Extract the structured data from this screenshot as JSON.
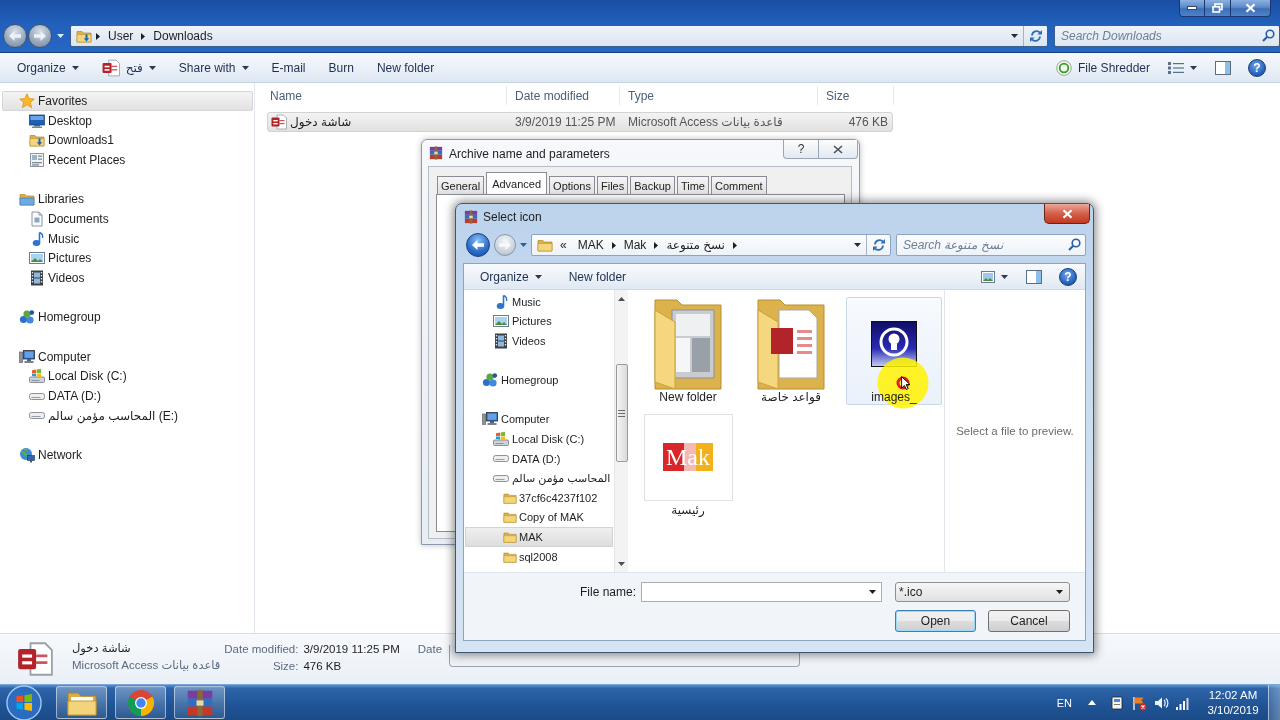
{
  "explorer": {
    "address": {
      "path": [
        "User",
        "Downloads"
      ]
    },
    "search": {
      "placeholder": "Search Downloads"
    },
    "toolbar": [
      {
        "kind": "menu",
        "label": "Organize"
      },
      {
        "kind": "app-menu",
        "label": "فتح"
      },
      {
        "kind": "menu",
        "label": "Share with"
      },
      {
        "kind": "command",
        "label": "E-mail"
      },
      {
        "kind": "command",
        "label": "Burn"
      },
      {
        "kind": "command",
        "label": "New folder"
      }
    ],
    "shredder": {
      "label": "File Shredder"
    },
    "help": "?",
    "sidebar": [
      {
        "label": "Favorites",
        "kind": "favorites",
        "selected": true,
        "children": [
          {
            "label": "Desktop",
            "kind": "desktop",
            "selected": false
          },
          {
            "label": "Downloads1",
            "kind": "downloads",
            "selected": false
          },
          {
            "label": "Recent Places",
            "kind": "recent",
            "selected": false
          }
        ]
      },
      {
        "label": "Libraries",
        "kind": "libraries",
        "selected": false,
        "children": [
          {
            "label": "Documents",
            "kind": "documents",
            "selected": false
          },
          {
            "label": "Music",
            "kind": "music",
            "selected": false
          },
          {
            "label": "Pictures",
            "kind": "pictures",
            "selected": false
          },
          {
            "label": "Videos",
            "kind": "videos",
            "selected": false
          }
        ]
      },
      {
        "label": "Homegroup",
        "kind": "homegroup",
        "selected": false
      },
      {
        "label": "Computer",
        "kind": "computer",
        "selected": false,
        "children": [
          {
            "label": "Local Disk (C:)",
            "kind": "system-drive",
            "selected": false
          },
          {
            "label": "DATA (D:)",
            "kind": "drive",
            "selected": false
          },
          {
            "label": "المحاسب مؤمن سالم (E:)",
            "kind": "drive",
            "selected": false
          }
        ]
      },
      {
        "label": "Network",
        "kind": "network",
        "selected": false
      }
    ],
    "columns": [
      "Name",
      "Date modified",
      "Type",
      "Size"
    ],
    "rows": [
      {
        "name": "شاشة دخول",
        "date_modified": "3/9/2019 11:25 PM",
        "type": "Microsoft Access قاعدة بيانات",
        "size": "476 KB",
        "selected": true
      }
    ],
    "details": {
      "name": "شاشة دخول",
      "type": "Microsoft Access قاعدة بيانات",
      "field_columns": [
        [
          {
            "label": "Date modified:",
            "value": "3/9/2019 11:25 PM"
          },
          {
            "label": "Size:",
            "value": "476 KB"
          }
        ],
        [
          {
            "label": "Date"
          }
        ]
      ]
    }
  },
  "archive_dialog": {
    "title": "Archive name and parameters",
    "help": "?",
    "tabs": [
      {
        "label": "General",
        "selected": false
      },
      {
        "label": "Advanced",
        "selected": true
      },
      {
        "label": "Options",
        "selected": false
      },
      {
        "label": "Files",
        "selected": false
      },
      {
        "label": "Backup",
        "selected": false
      },
      {
        "label": "Time",
        "selected": false
      },
      {
        "label": "Comment",
        "selected": false
      }
    ]
  },
  "select_icon_dialog": {
    "title": "Select icon",
    "address": {
      "overflow": "«",
      "path": [
        "MAK",
        "Mak",
        "نسخ متنوعة"
      ]
    },
    "search": {
      "placeholder": "Search نسخ متنوعة"
    },
    "toolbar": [
      {
        "kind": "menu",
        "label": "Organize"
      },
      {
        "kind": "command",
        "label": "New folder"
      }
    ],
    "help": "?",
    "tree": [
      {
        "children": [
          {
            "label": "Music",
            "kind": "music",
            "selected": false
          },
          {
            "label": "Pictures",
            "kind": "pictures",
            "selected": false
          },
          {
            "label": "Videos",
            "kind": "videos",
            "selected": false
          }
        ]
      },
      {
        "label": "Homegroup",
        "kind": "homegroup",
        "selected": false
      },
      {
        "label": "Computer",
        "kind": "computer",
        "selected": false,
        "children": [
          {
            "label": "Local Disk (C:)",
            "kind": "system-drive",
            "selected": false
          },
          {
            "label": "DATA (D:)",
            "kind": "drive",
            "selected": false
          },
          {
            "label": "المحاسب مؤمن سالم",
            "kind": "drive",
            "selected": false,
            "children": [
              {
                "label": "37cf6c4237f102",
                "kind": "folder",
                "selected": false
              },
              {
                "label": "Copy of MAK",
                "kind": "folder",
                "selected": false
              },
              {
                "label": "MAK",
                "kind": "folder",
                "selected": true
              },
              {
                "label": "sql2008",
                "kind": "folder",
                "selected": false
              }
            ]
          }
        ]
      }
    ],
    "items": [
      {
        "label": "New folder",
        "kind": "folder-documents",
        "hovered": false
      },
      {
        "label": "قواعد خاصة",
        "kind": "folder-access",
        "hovered": false
      },
      {
        "label": "images_",
        "kind": "icon-bulb",
        "hovered": true
      },
      {
        "label": "رئيسية",
        "kind": "icon-logo",
        "logo_text": "Mak",
        "hovered": false
      }
    ],
    "preview": "Select a file to preview.",
    "file_name": {
      "label": "File name:"
    },
    "file_type": {
      "value": "*.ico"
    },
    "buttons": [
      {
        "label": "Open",
        "kind": "default"
      },
      {
        "label": "Cancel",
        "kind": "normal"
      }
    ]
  },
  "taskbar": {
    "apps": [
      {
        "kind": "explorer"
      },
      {
        "kind": "chrome"
      },
      {
        "kind": "winrar"
      }
    ],
    "language": "EN",
    "time": "12:02 AM",
    "date": "3/10/2019"
  }
}
